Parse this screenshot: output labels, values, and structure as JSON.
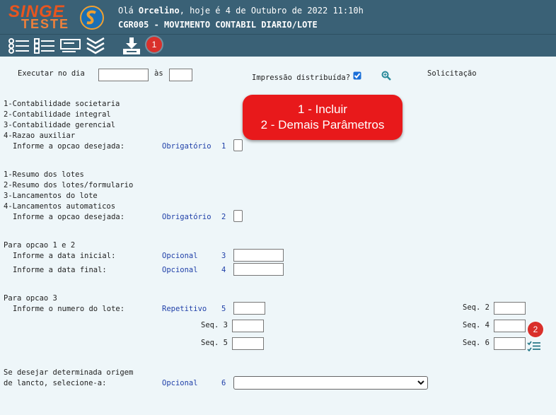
{
  "header": {
    "logo_top": "SINGE",
    "logo_bottom": "TESTE",
    "greeting_prefix": "Olá ",
    "user": "Orcelino",
    "greeting_suffix": ", hoje é 4 de Outubro de 2022 11:10h",
    "screen_title": "CGR005 - MOVIMENTO CONTABIL DIARIO/LOTE"
  },
  "toolbar": {
    "badge1": "1"
  },
  "form": {
    "executar_label": "Executar no dia",
    "as_label": "às",
    "impressao_label": "Impressão distribuída?",
    "solicitacao_label": "Solicitação",
    "group1": [
      "1-Contabilidade societaria",
      "2-Contabilidade integral",
      "3-Contabilidade gerencial",
      "4-Razao auxiliar"
    ],
    "informe_opcao": "Informe a opcao desejada:",
    "obrigatorio": "Obrigatório",
    "num1": "1",
    "group2": [
      "1-Resumo dos lotes",
      "2-Resumo dos lotes/formulario",
      "3-Lancamentos do lote",
      "4-Lancamentos automaticos"
    ],
    "num2": "2",
    "para_12": "Para opcao 1 e 2",
    "data_inicial": "Informe a data inicial:",
    "data_final": "Informe a data final:",
    "opcional": "Opcional",
    "num3": "3",
    "num4": "4",
    "para_3": "Para opcao 3",
    "numero_lote": "Informe o numero do lote:",
    "repetitivo": "Repetitivo",
    "num5": "5",
    "seq2": "Seq. 2",
    "seq3": "Seq. 3",
    "seq4": "Seq. 4",
    "seq5": "Seq. 5",
    "seq6": "Seq. 6",
    "origem1": "Se desejar determinada origem",
    "origem2": "de lancto, selecione-a:",
    "num6": "6",
    "badge2": "2"
  },
  "callout": {
    "line1": "1 - Incluir",
    "line2": "2 - Demais Parâmetros"
  }
}
